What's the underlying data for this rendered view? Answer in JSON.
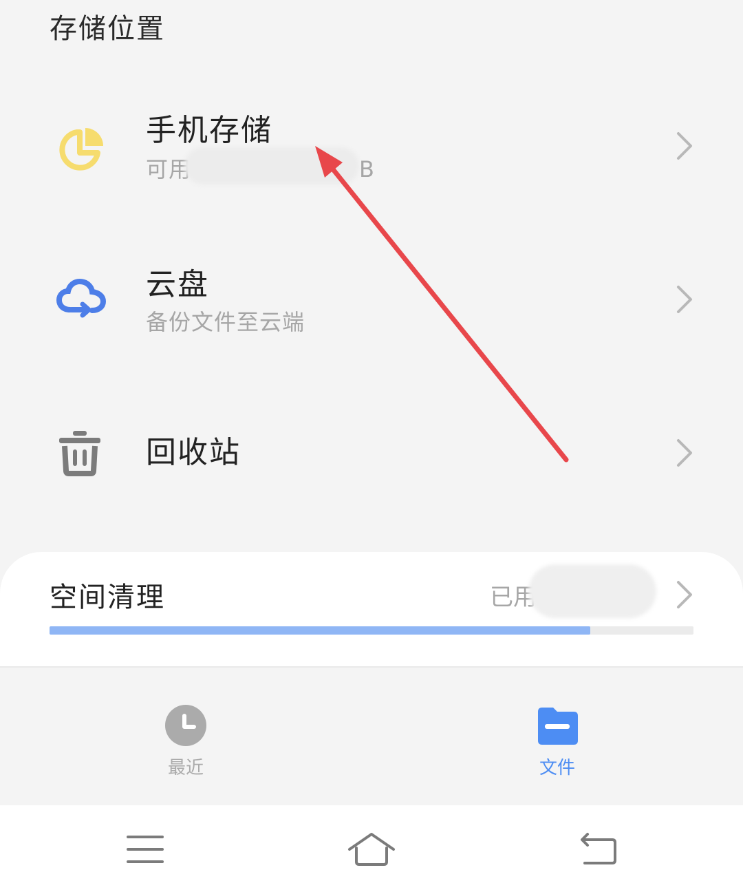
{
  "section": {
    "title": "存储位置"
  },
  "storage_items": [
    {
      "title": "手机存储",
      "subtitle_prefix": "可用",
      "subtitle_suffix": "B",
      "icon": "pie-chart-icon"
    },
    {
      "title": "云盘",
      "subtitle": "备份文件至云端",
      "icon": "cloud-sync-icon"
    },
    {
      "title": "回收站",
      "icon": "trash-icon"
    }
  ],
  "cleanup": {
    "title": "空间清理",
    "used_prefix": "已用",
    "progress_fraction": 0.84
  },
  "tabs": [
    {
      "label": "最近",
      "icon": "clock-icon",
      "active": false
    },
    {
      "label": "文件",
      "icon": "folder-icon",
      "active": true
    }
  ],
  "nav": {
    "menu_icon": "menu-icon",
    "home_icon": "home-icon",
    "back_icon": "back-icon"
  },
  "colors": {
    "accent_blue": "#4d8df3",
    "icon_yellow": "#f6dc6e",
    "inactive_gray": "#ababab",
    "annotation_red": "#e8474b"
  }
}
